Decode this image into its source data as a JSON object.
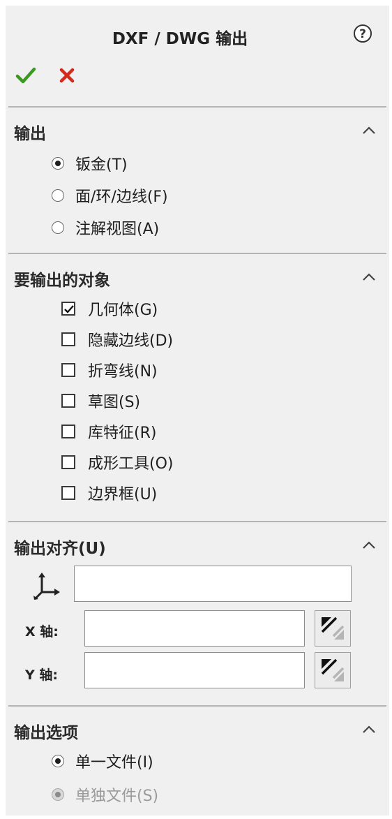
{
  "header": {
    "title": "DXF / DWG 输出",
    "help_icon": "help-icon",
    "ok_icon": "checkmark-icon",
    "cancel_icon": "close-icon"
  },
  "sections": {
    "output": {
      "title": "输出",
      "options": [
        {
          "label": "钣金(T)",
          "selected": true
        },
        {
          "label": "面/环/边线(F)",
          "selected": false
        },
        {
          "label": "注解视图(A)",
          "selected": false
        }
      ]
    },
    "entities": {
      "title": "要输出的对象",
      "items": [
        {
          "label": "几何体(G)",
          "checked": true
        },
        {
          "label": "隐藏边线(D)",
          "checked": false
        },
        {
          "label": "折弯线(N)",
          "checked": false
        },
        {
          "label": "草图(S)",
          "checked": false
        },
        {
          "label": "库特征(R)",
          "checked": false
        },
        {
          "label": "成形工具(O)",
          "checked": false
        },
        {
          "label": "边界框(U)",
          "checked": false
        }
      ]
    },
    "alignment": {
      "title": "输出对齐(U)",
      "origin_value": "",
      "x_axis_label": "X 轴:",
      "x_axis_value": "",
      "y_axis_label": "Y 轴:",
      "y_axis_value": ""
    },
    "options": {
      "title": "输出选项",
      "choices": [
        {
          "label": "单一文件(I)",
          "selected": true,
          "enabled": true
        },
        {
          "label": "单独文件(S)",
          "selected": true,
          "enabled": false
        }
      ]
    }
  },
  "colors": {
    "ok": "#3a9a1e",
    "cancel": "#d42a1c",
    "panel_bg": "#f0f0f0"
  }
}
